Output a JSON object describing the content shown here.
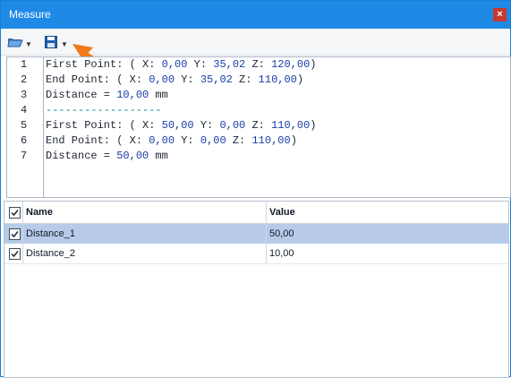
{
  "window": {
    "title": "Measure",
    "close": "×"
  },
  "toolbar": {
    "open_icon": "folder-open-icon",
    "save_icon": "save-icon"
  },
  "editor": {
    "lines": [
      {
        "n": "1",
        "text": "First Point: ( X: 0,00 Y: 35,02 Z: 120,00)"
      },
      {
        "n": "2",
        "text": "End Point: ( X: 0,00 Y: 35,02 Z: 110,00)"
      },
      {
        "n": "3",
        "text": "Distance = 10,00 mm"
      },
      {
        "n": "4",
        "text": "------------------"
      },
      {
        "n": "5",
        "text": "First Point: ( X: 50,00 Y: 0,00 Z: 110,00)"
      },
      {
        "n": "6",
        "text": "End Point: ( X: 0,00 Y: 0,00 Z: 110,00)"
      },
      {
        "n": "7",
        "text": "Distance = 50,00 mm"
      }
    ]
  },
  "table": {
    "headers": {
      "name": "Name",
      "value": "Value"
    },
    "rows": [
      {
        "name": "Distance_1",
        "value": "50,00",
        "checked": true,
        "selected": true
      },
      {
        "name": "Distance_2",
        "value": "10,00",
        "checked": true,
        "selected": false
      }
    ]
  },
  "colors": {
    "titlebar": "#1e8ae6",
    "selection": "#b7cbe9",
    "number": "#1b3ea8",
    "separator": "#0f8a8a",
    "arrow": "#f07a1a"
  }
}
